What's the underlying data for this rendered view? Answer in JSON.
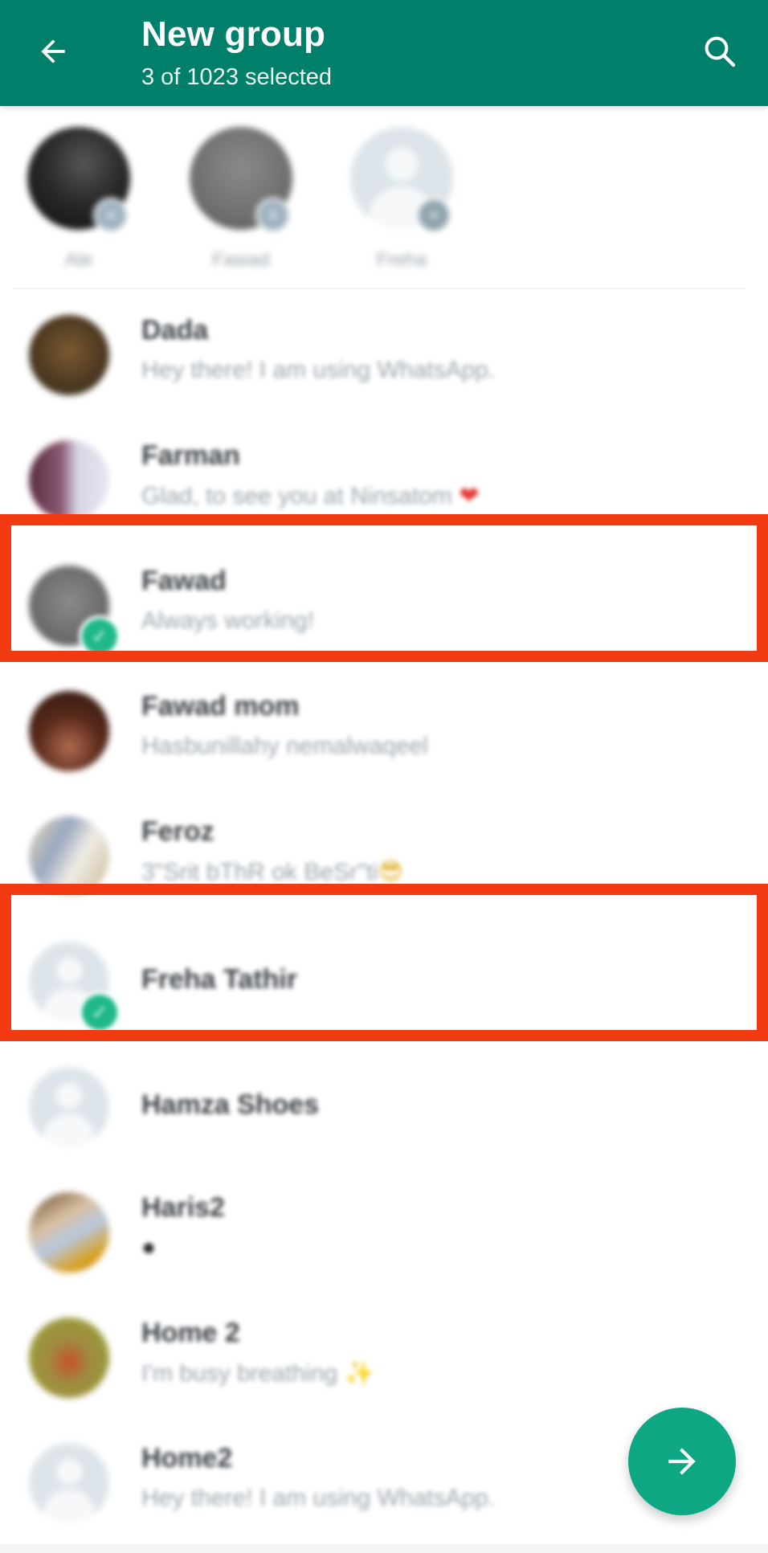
{
  "header": {
    "title": "New group",
    "subtitle": "3 of 1023 selected",
    "back_icon": "arrow-back-icon",
    "search_icon": "search-icon",
    "background_color": "#00806a"
  },
  "selected_strip": {
    "items": [
      {
        "label": "Ale",
        "remove_icon": "close-icon"
      },
      {
        "label": "Fawad",
        "remove_icon": "close-icon"
      },
      {
        "label": "Freha",
        "remove_icon": "close-icon"
      }
    ]
  },
  "contacts": [
    {
      "name": "Dada",
      "status": "Hey there! I am using WhatsApp.",
      "selected": false
    },
    {
      "name": "Farman",
      "status": "Glad, to see you at Ninsatom",
      "status_emoji": "❤",
      "selected": false
    },
    {
      "name": "Fawad",
      "status": "Always working!",
      "selected": true
    },
    {
      "name": "Fawad mom",
      "status": "Hasbunillahy nemalwaqeel",
      "selected": false
    },
    {
      "name": "Feroz",
      "status": "3\"Srit bThR ok BeSr\"ti",
      "status_emoji": "😎",
      "selected": false
    },
    {
      "name": "Freha Tathir",
      "status": "",
      "selected": true
    },
    {
      "name": "Hamza Shoes",
      "status": "",
      "selected": false
    },
    {
      "name": "Haris2",
      "status": "",
      "status_emoji": "●",
      "selected": false
    },
    {
      "name": "Home 2",
      "status": "I'm busy breathing",
      "status_emoji": "✨",
      "selected": false
    },
    {
      "name": "Home2",
      "status": "Hey there! I am using WhatsApp.",
      "selected": false
    }
  ],
  "fab": {
    "icon": "arrow-forward-icon",
    "color": "#0da784"
  },
  "annotations": {
    "highlight_color": "#f23a12",
    "highlighted_contacts": [
      "Fawad",
      "Freha Tathir"
    ]
  },
  "check_icon": "✓",
  "remove_glyph": "×"
}
